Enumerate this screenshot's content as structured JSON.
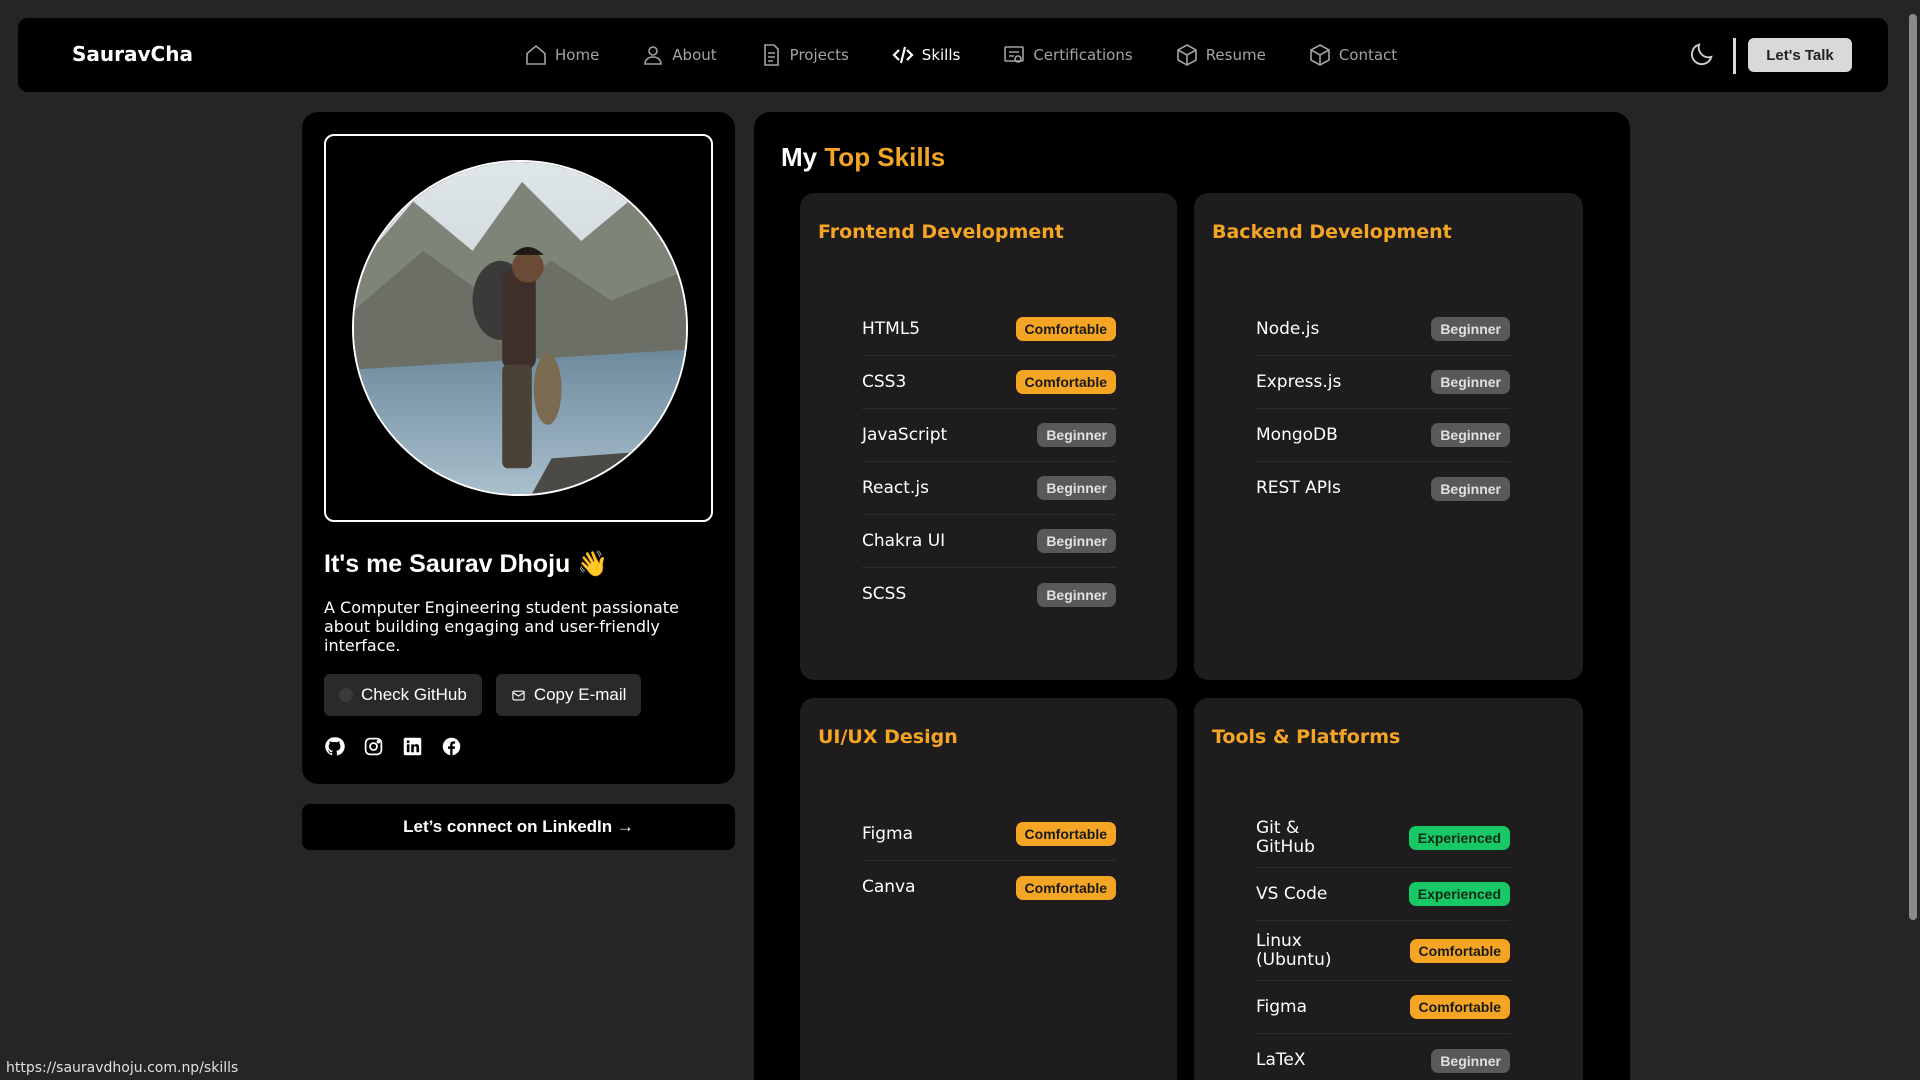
{
  "nav": {
    "brand": "SauravCha",
    "items": [
      {
        "label": "Home",
        "icon": "home-icon"
      },
      {
        "label": "About",
        "icon": "user-icon"
      },
      {
        "label": "Projects",
        "icon": "document-icon"
      },
      {
        "label": "Skills",
        "icon": "code-icon",
        "active": true
      },
      {
        "label": "Certifications",
        "icon": "certificate-icon"
      },
      {
        "label": "Resume",
        "icon": "cube-icon"
      },
      {
        "label": "Contact",
        "icon": "cube-icon"
      }
    ],
    "theme_icon": "moon-icon",
    "cta_label": "Let's Talk"
  },
  "profile": {
    "name": "It's me Saurav Dhoju 👋",
    "bio": "A Computer Engineering student passionate about building engaging and user-friendly interface.",
    "github_button": "Check GitHub",
    "email_button": "Copy E-mail",
    "socials": [
      "github-icon",
      "instagram-icon",
      "linkedin-icon",
      "facebook-icon"
    ],
    "linkedin_cta": "Let’s connect on LinkedIn →"
  },
  "skills": {
    "title_prefix": "My",
    "title_accent": "Top Skills",
    "categories": [
      {
        "title": "Frontend Development",
        "items": [
          {
            "name": "HTML5",
            "level": "Comfortable"
          },
          {
            "name": "CSS3",
            "level": "Comfortable"
          },
          {
            "name": "JavaScript",
            "level": "Beginner"
          },
          {
            "name": "React.js",
            "level": "Beginner"
          },
          {
            "name": "Chakra UI",
            "level": "Beginner"
          },
          {
            "name": "SCSS",
            "level": "Beginner"
          }
        ]
      },
      {
        "title": "Backend Development",
        "items": [
          {
            "name": "Node.js",
            "level": "Beginner"
          },
          {
            "name": "Express.js",
            "level": "Beginner"
          },
          {
            "name": "MongoDB",
            "level": "Beginner"
          },
          {
            "name": "REST APIs",
            "level": "Beginner"
          }
        ]
      },
      {
        "title": "UI/UX Design",
        "items": [
          {
            "name": "Figma",
            "level": "Comfortable"
          },
          {
            "name": "Canva",
            "level": "Comfortable"
          }
        ]
      },
      {
        "title": "Tools & Platforms",
        "items": [
          {
            "name": "Git & GitHub",
            "level": "Experienced"
          },
          {
            "name": "VS Code",
            "level": "Experienced"
          },
          {
            "name": "Linux (Ubuntu)",
            "level": "Comfortable"
          },
          {
            "name": "Figma",
            "level": "Comfortable"
          },
          {
            "name": "LaTeX",
            "level": "Beginner"
          }
        ]
      }
    ]
  },
  "status_url": "https://sauravdhoju.com.np/skills",
  "colors": {
    "accent": "#f5a524",
    "experienced": "#17c964",
    "beginner": "#595959",
    "background": "#262424"
  }
}
